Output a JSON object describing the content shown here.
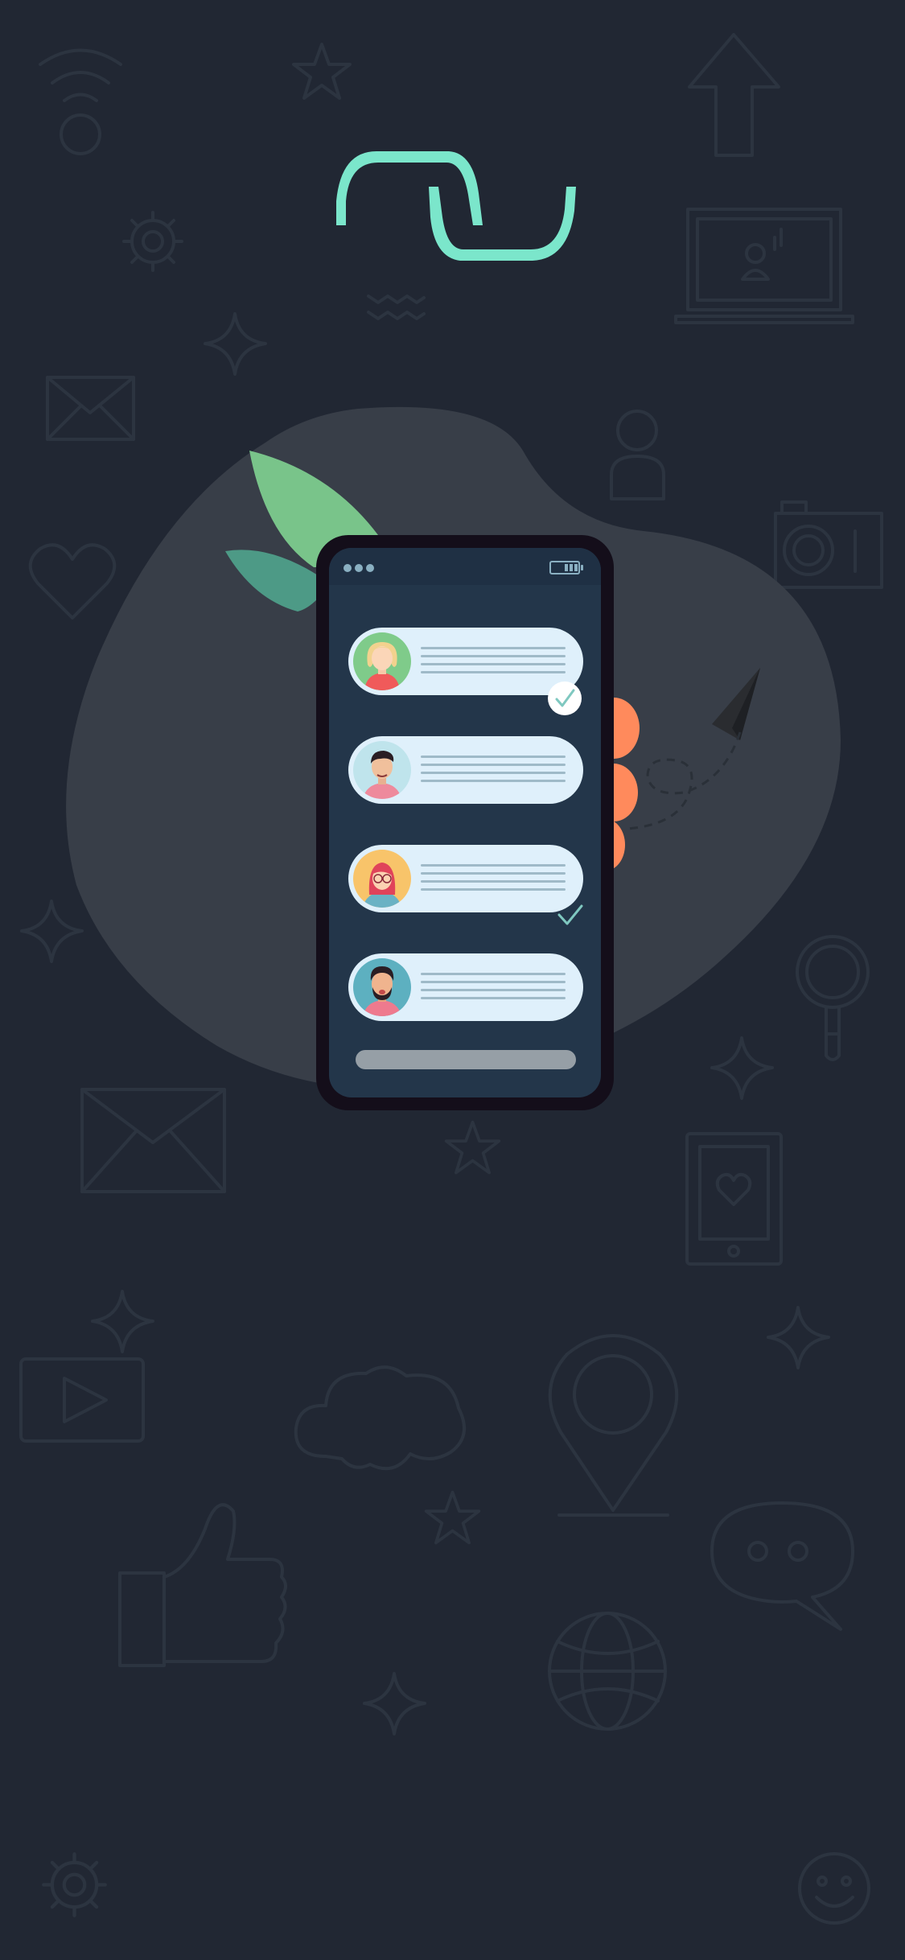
{
  "screen": {
    "background_color": "#212733",
    "accent_color": "#7be6cb",
    "blob_color": "#383e48"
  },
  "logo": {
    "icon": "wave-logo-icon",
    "color": "#7be6cb"
  },
  "phone": {
    "status_bar": {
      "icons": [
        "signal-dots-icon",
        "battery-icon"
      ]
    },
    "messages": [
      {
        "avatar": "avatar-woman-blonde",
        "status": "check-badge-icon"
      },
      {
        "avatar": "avatar-man-dark-hair",
        "status": "none"
      },
      {
        "avatar": "avatar-woman-red-hair",
        "status": "check-icon"
      },
      {
        "avatar": "avatar-man-beard",
        "status": "none"
      }
    ],
    "home_indicator": "home-indicator"
  },
  "decorations": [
    "wifi-icon",
    "star-icon",
    "arrow-up-icon",
    "gear-icon",
    "laptop-icon",
    "waves-icon",
    "mail-icon",
    "user-icon",
    "camera-icon",
    "heart-icon",
    "paper-plane-icon",
    "magnifier-icon",
    "video-play-icon",
    "cloud-icon",
    "location-pin-icon",
    "thumbs-up-icon",
    "chat-bubble-icon",
    "globe-icon",
    "smiley-icon",
    "tablet-heart-icon",
    "leaves-icon",
    "hand-icon"
  ]
}
